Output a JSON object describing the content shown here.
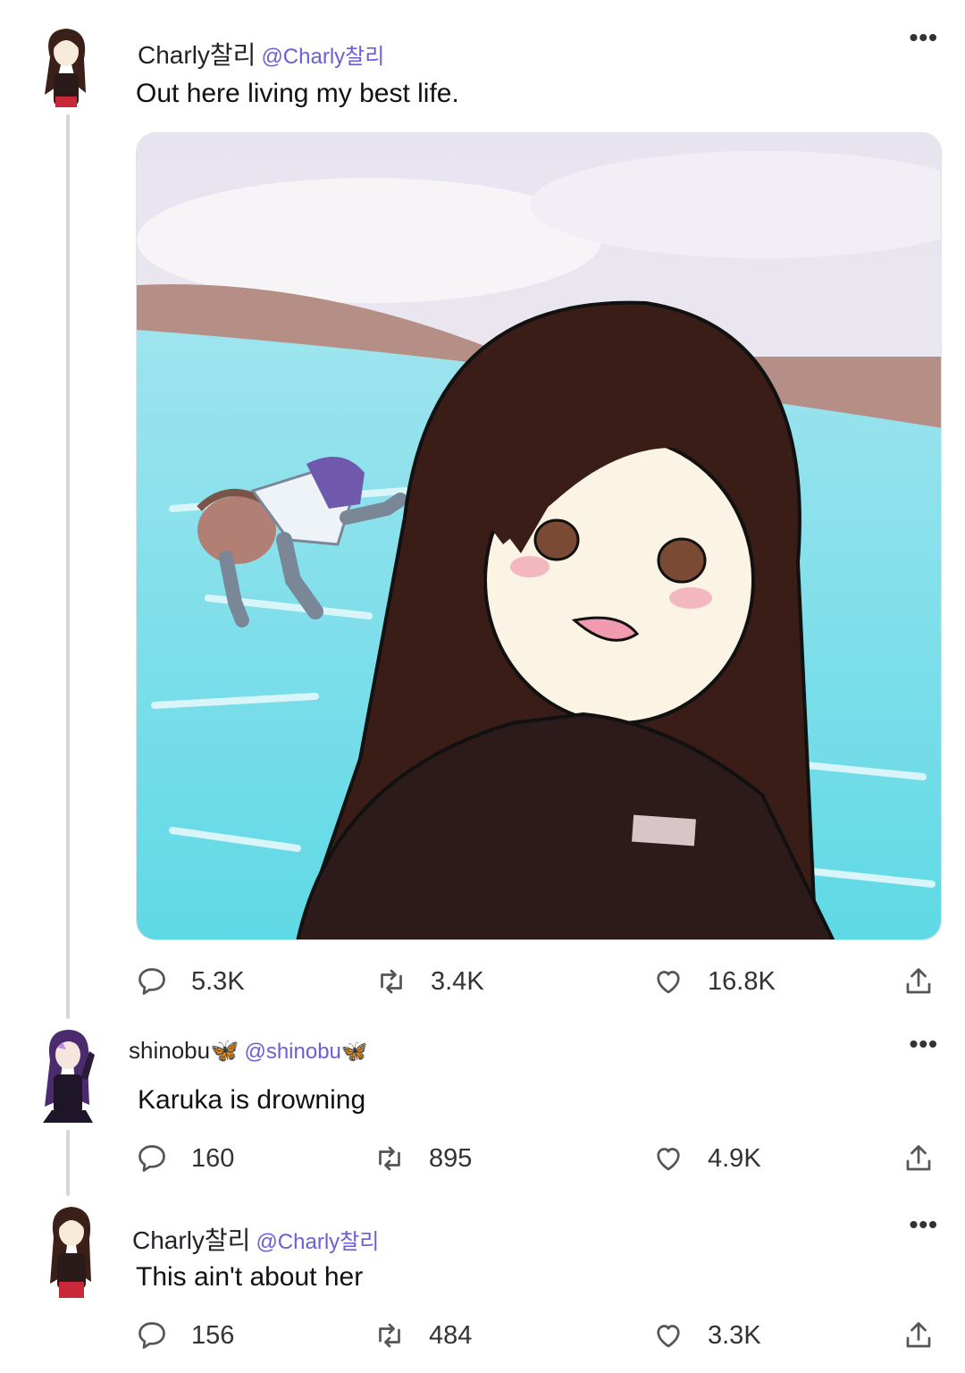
{
  "thread": [
    {
      "display_name": "Charly찰리",
      "handle": "@Charly찰리",
      "text": "Out here living my best life.",
      "has_media": true,
      "stats": {
        "replies": "5.3K",
        "retweets": "3.4K",
        "likes": "16.8K"
      }
    },
    {
      "display_name": "shinobu🦋",
      "handle": "@shinobu🦋",
      "text": "Karuka is drowning",
      "has_media": false,
      "stats": {
        "replies": "160",
        "retweets": "895",
        "likes": "4.9K"
      }
    },
    {
      "display_name": "Charly찰리",
      "handle": "@Charly찰리",
      "text": "This ain't about her",
      "has_media": false,
      "stats": {
        "replies": "156",
        "retweets": "484",
        "likes": "3.3K"
      }
    }
  ],
  "icons": {
    "reply": "reply-icon",
    "retweet": "retweet-icon",
    "like": "heart-icon",
    "share": "share-icon",
    "more": "more-icon"
  },
  "colors": {
    "handle": "#6b5fd6",
    "thread_line": "#cfd9de",
    "icon": "#555555"
  }
}
